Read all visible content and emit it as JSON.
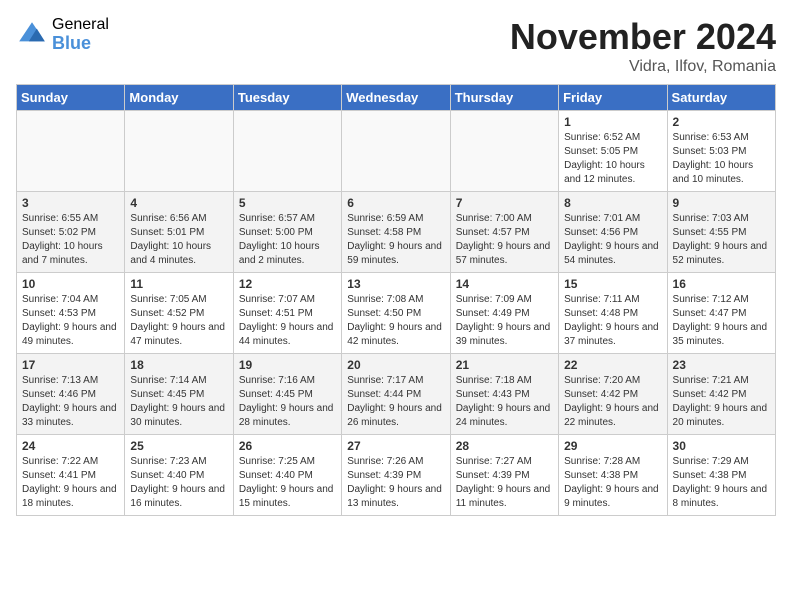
{
  "header": {
    "logo_general": "General",
    "logo_blue": "Blue",
    "month_title": "November 2024",
    "location": "Vidra, Ilfov, Romania"
  },
  "weekdays": [
    "Sunday",
    "Monday",
    "Tuesday",
    "Wednesday",
    "Thursday",
    "Friday",
    "Saturday"
  ],
  "weeks": [
    [
      {
        "day": "",
        "info": ""
      },
      {
        "day": "",
        "info": ""
      },
      {
        "day": "",
        "info": ""
      },
      {
        "day": "",
        "info": ""
      },
      {
        "day": "",
        "info": ""
      },
      {
        "day": "1",
        "info": "Sunrise: 6:52 AM\nSunset: 5:05 PM\nDaylight: 10 hours and 12 minutes."
      },
      {
        "day": "2",
        "info": "Sunrise: 6:53 AM\nSunset: 5:03 PM\nDaylight: 10 hours and 10 minutes."
      }
    ],
    [
      {
        "day": "3",
        "info": "Sunrise: 6:55 AM\nSunset: 5:02 PM\nDaylight: 10 hours and 7 minutes."
      },
      {
        "day": "4",
        "info": "Sunrise: 6:56 AM\nSunset: 5:01 PM\nDaylight: 10 hours and 4 minutes."
      },
      {
        "day": "5",
        "info": "Sunrise: 6:57 AM\nSunset: 5:00 PM\nDaylight: 10 hours and 2 minutes."
      },
      {
        "day": "6",
        "info": "Sunrise: 6:59 AM\nSunset: 4:58 PM\nDaylight: 9 hours and 59 minutes."
      },
      {
        "day": "7",
        "info": "Sunrise: 7:00 AM\nSunset: 4:57 PM\nDaylight: 9 hours and 57 minutes."
      },
      {
        "day": "8",
        "info": "Sunrise: 7:01 AM\nSunset: 4:56 PM\nDaylight: 9 hours and 54 minutes."
      },
      {
        "day": "9",
        "info": "Sunrise: 7:03 AM\nSunset: 4:55 PM\nDaylight: 9 hours and 52 minutes."
      }
    ],
    [
      {
        "day": "10",
        "info": "Sunrise: 7:04 AM\nSunset: 4:53 PM\nDaylight: 9 hours and 49 minutes."
      },
      {
        "day": "11",
        "info": "Sunrise: 7:05 AM\nSunset: 4:52 PM\nDaylight: 9 hours and 47 minutes."
      },
      {
        "day": "12",
        "info": "Sunrise: 7:07 AM\nSunset: 4:51 PM\nDaylight: 9 hours and 44 minutes."
      },
      {
        "day": "13",
        "info": "Sunrise: 7:08 AM\nSunset: 4:50 PM\nDaylight: 9 hours and 42 minutes."
      },
      {
        "day": "14",
        "info": "Sunrise: 7:09 AM\nSunset: 4:49 PM\nDaylight: 9 hours and 39 minutes."
      },
      {
        "day": "15",
        "info": "Sunrise: 7:11 AM\nSunset: 4:48 PM\nDaylight: 9 hours and 37 minutes."
      },
      {
        "day": "16",
        "info": "Sunrise: 7:12 AM\nSunset: 4:47 PM\nDaylight: 9 hours and 35 minutes."
      }
    ],
    [
      {
        "day": "17",
        "info": "Sunrise: 7:13 AM\nSunset: 4:46 PM\nDaylight: 9 hours and 33 minutes."
      },
      {
        "day": "18",
        "info": "Sunrise: 7:14 AM\nSunset: 4:45 PM\nDaylight: 9 hours and 30 minutes."
      },
      {
        "day": "19",
        "info": "Sunrise: 7:16 AM\nSunset: 4:45 PM\nDaylight: 9 hours and 28 minutes."
      },
      {
        "day": "20",
        "info": "Sunrise: 7:17 AM\nSunset: 4:44 PM\nDaylight: 9 hours and 26 minutes."
      },
      {
        "day": "21",
        "info": "Sunrise: 7:18 AM\nSunset: 4:43 PM\nDaylight: 9 hours and 24 minutes."
      },
      {
        "day": "22",
        "info": "Sunrise: 7:20 AM\nSunset: 4:42 PM\nDaylight: 9 hours and 22 minutes."
      },
      {
        "day": "23",
        "info": "Sunrise: 7:21 AM\nSunset: 4:42 PM\nDaylight: 9 hours and 20 minutes."
      }
    ],
    [
      {
        "day": "24",
        "info": "Sunrise: 7:22 AM\nSunset: 4:41 PM\nDaylight: 9 hours and 18 minutes."
      },
      {
        "day": "25",
        "info": "Sunrise: 7:23 AM\nSunset: 4:40 PM\nDaylight: 9 hours and 16 minutes."
      },
      {
        "day": "26",
        "info": "Sunrise: 7:25 AM\nSunset: 4:40 PM\nDaylight: 9 hours and 15 minutes."
      },
      {
        "day": "27",
        "info": "Sunrise: 7:26 AM\nSunset: 4:39 PM\nDaylight: 9 hours and 13 minutes."
      },
      {
        "day": "28",
        "info": "Sunrise: 7:27 AM\nSunset: 4:39 PM\nDaylight: 9 hours and 11 minutes."
      },
      {
        "day": "29",
        "info": "Sunrise: 7:28 AM\nSunset: 4:38 PM\nDaylight: 9 hours and 9 minutes."
      },
      {
        "day": "30",
        "info": "Sunrise: 7:29 AM\nSunset: 4:38 PM\nDaylight: 9 hours and 8 minutes."
      }
    ]
  ]
}
